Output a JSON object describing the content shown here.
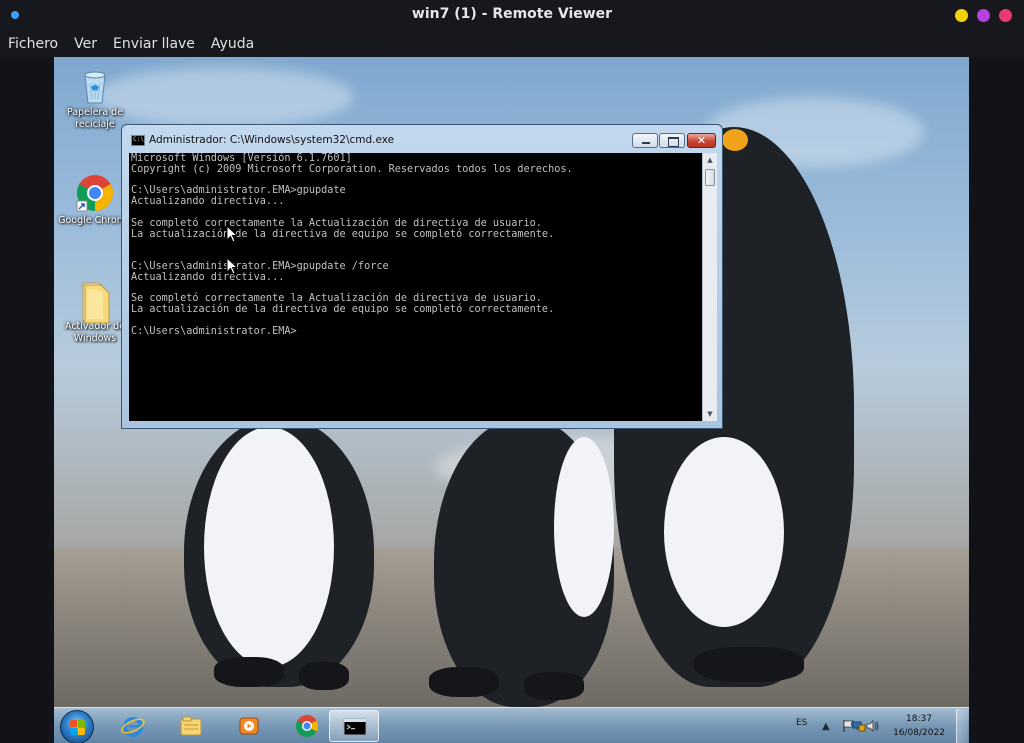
{
  "viewer": {
    "title": "win7 (1) - Remote Viewer",
    "menu": [
      "Fichero",
      "Ver",
      "Enviar llave",
      "Ayuda"
    ],
    "window_buttons": [
      "#f5d10c",
      "#b640e0",
      "#ea3b6e"
    ]
  },
  "desktop": {
    "icons": [
      {
        "name": "recycle-bin",
        "label": "Papelera de reciclaje"
      },
      {
        "name": "google-chrome",
        "label": "Google Chrome"
      },
      {
        "name": "activador-folder",
        "label": "Activador de Windows"
      }
    ]
  },
  "cmd": {
    "title": "Administrador: C:\\Windows\\system32\\cmd.exe",
    "icon_text": "C:\\",
    "lines": [
      "Microsoft Windows [Versión 6.1.7601]",
      "Copyright (c) 2009 Microsoft Corporation. Reservados todos los derechos.",
      "",
      "C:\\Users\\administrator.EMA>gpupdate",
      "Actualizando directiva...",
      "",
      "Se completó correctamente la Actualización de directiva de usuario.",
      "La actualización de la directiva de equipo se completó correctamente.",
      "",
      "",
      "C:\\Users\\administrator.EMA>gpupdate /force",
      "Actualizando directiva...",
      "",
      "Se completó correctamente la Actualización de directiva de usuario.",
      "La actualización de la directiva de equipo se completó correctamente.",
      "",
      "C:\\Users\\administrator.EMA>"
    ]
  },
  "taskbar": {
    "apps": [
      "internet-explorer",
      "windows-explorer",
      "media-player",
      "google-chrome",
      "command-prompt"
    ],
    "active_app": "command-prompt",
    "language": "ES",
    "time": "18:37",
    "date": "16/08/2022"
  }
}
